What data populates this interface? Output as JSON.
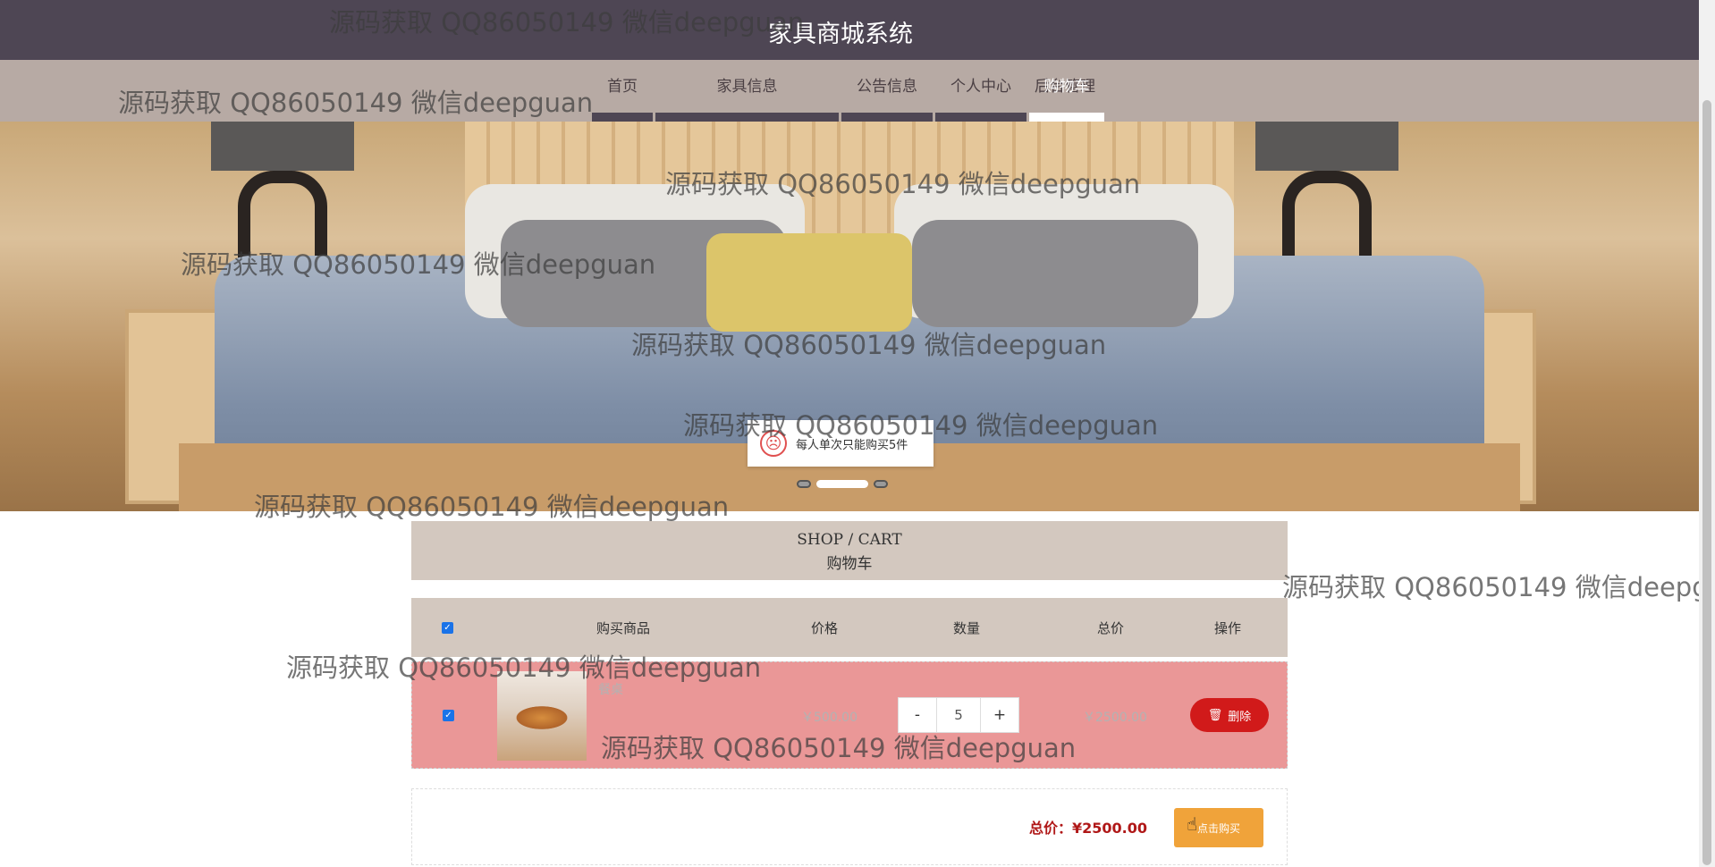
{
  "header": {
    "site_title": "家具商城系统"
  },
  "nav": {
    "items": [
      {
        "label": "首页"
      },
      {
        "label": "家具信息"
      },
      {
        "label": "公告信息"
      },
      {
        "label": "个人中心"
      },
      {
        "label": "后台管理"
      },
      {
        "label": "购物车"
      }
    ],
    "active_index": 5
  },
  "banner": {
    "slide_count": 3,
    "active_slide": 2,
    "toast": {
      "icon": "sad-face-icon",
      "message": "每人单次只能购买5件"
    }
  },
  "cart": {
    "heading_en": "SHOP / CART",
    "heading_zh": "购物车",
    "columns": [
      "购买商品",
      "价格",
      "数量",
      "总价",
      "操作"
    ],
    "select_all_checked": true,
    "items": [
      {
        "checked": true,
        "image_icon": "dining-table-thumbnail",
        "name": "餐桌",
        "price": "￥500.00",
        "quantity": "5",
        "decrement_label": "-",
        "increment_label": "+",
        "subtotal": "￥2500.00",
        "delete_label": "删除",
        "delete_icon": "trash-icon"
      }
    ],
    "total_label": "总价：",
    "total_value": "¥2500.00",
    "buy_label": "点击购买",
    "buy_icon": "hand-pointer-icon"
  },
  "watermark": "源码获取 QQ86050149 微信deepguan",
  "colors": {
    "topbar": "#4e4654",
    "navbar": "#b7aaa4",
    "panel": "#d3c8bf",
    "row_highlight": "#ea9797",
    "delete_button": "#d11a1a",
    "buy_button": "#f0a33a",
    "total_text": "#b01818"
  }
}
